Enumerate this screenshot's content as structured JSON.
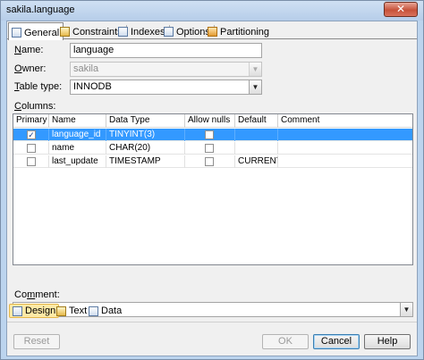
{
  "window": {
    "title": "sakila.language",
    "close_glyph": "✕"
  },
  "tabs": [
    {
      "label": "General",
      "icon": "table-icon",
      "active": true
    },
    {
      "label": "Constraints",
      "icon": "key-icon"
    },
    {
      "label": "Indexes",
      "icon": "index-icon"
    },
    {
      "label": "Options",
      "icon": "options-icon"
    },
    {
      "label": "Partitioning",
      "icon": "partition-icon"
    }
  ],
  "form": {
    "name_label_u": "N",
    "name_label_rest": "ame:",
    "name_value": "language",
    "owner_label_u": "O",
    "owner_label_rest": "wner:",
    "owner_value": "sakila",
    "type_label_u": "T",
    "type_label_rest": "able type:",
    "type_value": "INNODB",
    "columns_label_u": "C",
    "columns_label_rest": "olumns:",
    "comment_label_pre": "Co",
    "comment_label_u": "m",
    "comment_label_rest": "ment:",
    "comment_value": ""
  },
  "grid": {
    "headers": [
      "Primary",
      "Name",
      "Data Type",
      "Allow nulls",
      "Default",
      "Comment"
    ],
    "rows": [
      {
        "primary": true,
        "name": "language_id",
        "type": "TINYINT(3)",
        "nulls": false,
        "default": "",
        "comment": "",
        "selected": true
      },
      {
        "primary": false,
        "name": "name",
        "type": "CHAR(20)",
        "nulls": false,
        "default": "",
        "comment": ""
      },
      {
        "primary": false,
        "name": "last_update",
        "type": "TIMESTAMP",
        "nulls": false,
        "default": "CURRENT...",
        "comment": ""
      }
    ]
  },
  "view_tabs": [
    {
      "label": "Design",
      "active": true
    },
    {
      "label": "Text"
    },
    {
      "label": "Data"
    }
  ],
  "buttons": {
    "reset": "Reset",
    "ok": "OK",
    "cancel": "Cancel",
    "help": "Help"
  },
  "glyphs": {
    "check": "✓",
    "dropdown": "▼"
  }
}
